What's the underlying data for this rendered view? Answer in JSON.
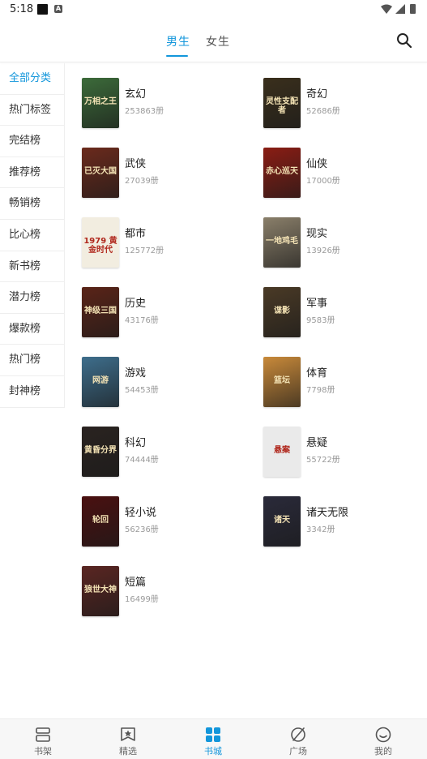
{
  "status_bar": {
    "time": "5:18"
  },
  "header": {
    "tabs": [
      {
        "label": "男生",
        "active": true
      },
      {
        "label": "女生",
        "active": false
      }
    ],
    "accent": "#1296db"
  },
  "sidebar": {
    "items": [
      {
        "label": "全部分类",
        "active": true
      },
      {
        "label": "热门标签"
      },
      {
        "label": "完结榜"
      },
      {
        "label": "推荐榜"
      },
      {
        "label": "畅销榜"
      },
      {
        "label": "比心榜"
      },
      {
        "label": "新书榜"
      },
      {
        "label": "潜力榜"
      },
      {
        "label": "爆款榜"
      },
      {
        "label": "热门榜"
      },
      {
        "label": "封神榜"
      }
    ]
  },
  "categories": [
    {
      "name": "玄幻",
      "count": "253863册",
      "cover_text": "万相之王",
      "cover_color": "#3c6b3a"
    },
    {
      "name": "奇幻",
      "count": "52686册",
      "cover_text": "灵性支配者",
      "cover_color": "#3a2f1c"
    },
    {
      "name": "武侠",
      "count": "27039册",
      "cover_text": "已灭大国",
      "cover_color": "#6b2a1c"
    },
    {
      "name": "仙侠",
      "count": "17000册",
      "cover_text": "赤心巡天",
      "cover_color": "#8a1d14"
    },
    {
      "name": "都市",
      "count": "125772册",
      "cover_text": "1979 黄金时代",
      "cover_color": "#f2ede0"
    },
    {
      "name": "现实",
      "count": "13926册",
      "cover_text": "一地鸡毛",
      "cover_color": "#8a7f6a"
    },
    {
      "name": "历史",
      "count": "43176册",
      "cover_text": "神级三国",
      "cover_color": "#5a2418"
    },
    {
      "name": "军事",
      "count": "9583册",
      "cover_text": "谍影",
      "cover_color": "#4a3a26"
    },
    {
      "name": "游戏",
      "count": "54453册",
      "cover_text": "网游",
      "cover_color": "#3e6e8c"
    },
    {
      "name": "体育",
      "count": "7798册",
      "cover_text": "篮坛",
      "cover_color": "#c98a3a"
    },
    {
      "name": "科幻",
      "count": "74444册",
      "cover_text": "黄昏分界",
      "cover_color": "#2a2320"
    },
    {
      "name": "悬疑",
      "count": "55722册",
      "cover_text": "悬案",
      "cover_color": "#eaeaea"
    },
    {
      "name": "轻小说",
      "count": "56236册",
      "cover_text": "轮回",
      "cover_color": "#4a1010"
    },
    {
      "name": "诸天无限",
      "count": "3342册",
      "cover_text": "诸天",
      "cover_color": "#2a2a3a"
    },
    {
      "name": "短篇",
      "count": "16499册",
      "cover_text": "狼世大神",
      "cover_color": "#5a2622"
    }
  ],
  "bottom_nav": {
    "items": [
      {
        "label": "书架",
        "icon": "bookshelf-icon"
      },
      {
        "label": "精选",
        "icon": "star-icon"
      },
      {
        "label": "书城",
        "icon": "grid-icon",
        "active": true
      },
      {
        "label": "广场",
        "icon": "plaza-icon"
      },
      {
        "label": "我的",
        "icon": "profile-icon"
      }
    ]
  }
}
